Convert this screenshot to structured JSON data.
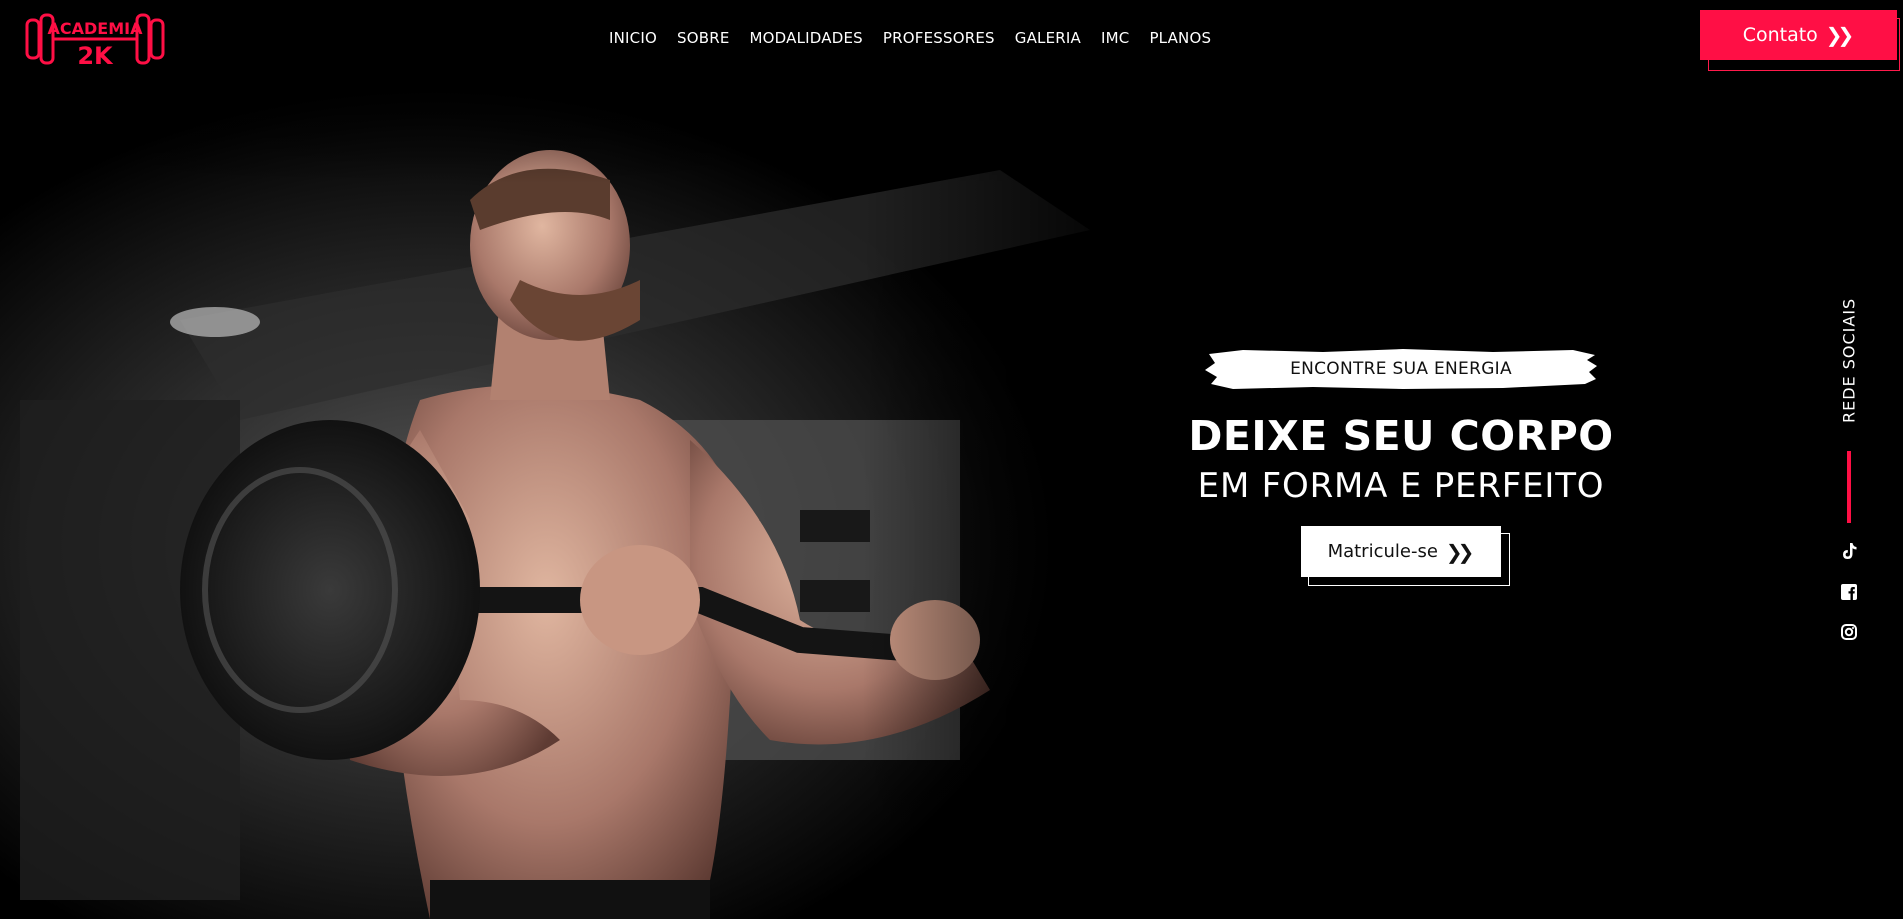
{
  "brand": {
    "logo_text_top": "ACADEMIA",
    "logo_text_bottom": "2K",
    "accent_color": "#ff0f45"
  },
  "nav": {
    "items": [
      {
        "label": "INICIO"
      },
      {
        "label": "SOBRE"
      },
      {
        "label": "MODALIDADES"
      },
      {
        "label": "PROFESSORES"
      },
      {
        "label": "GALERIA"
      },
      {
        "label": "IMC"
      },
      {
        "label": "PLANOS"
      }
    ]
  },
  "header": {
    "contact_label": "Contato",
    "contact_icon": "double-chevron-right-icon"
  },
  "hero": {
    "tagline": "ENCONTRE SUA ENERGIA",
    "headline_line1": "DEIXE SEU CORPO",
    "headline_line2": "EM FORMA E PERFEITO",
    "cta_label": "Matricule-se",
    "cta_icon": "double-chevron-right-icon",
    "photo": "man-lifting-barbell-photo"
  },
  "social": {
    "title": "REDE SOCIAIS",
    "icons": [
      {
        "name": "tiktok-icon"
      },
      {
        "name": "facebook-icon"
      },
      {
        "name": "instagram-icon"
      }
    ]
  }
}
